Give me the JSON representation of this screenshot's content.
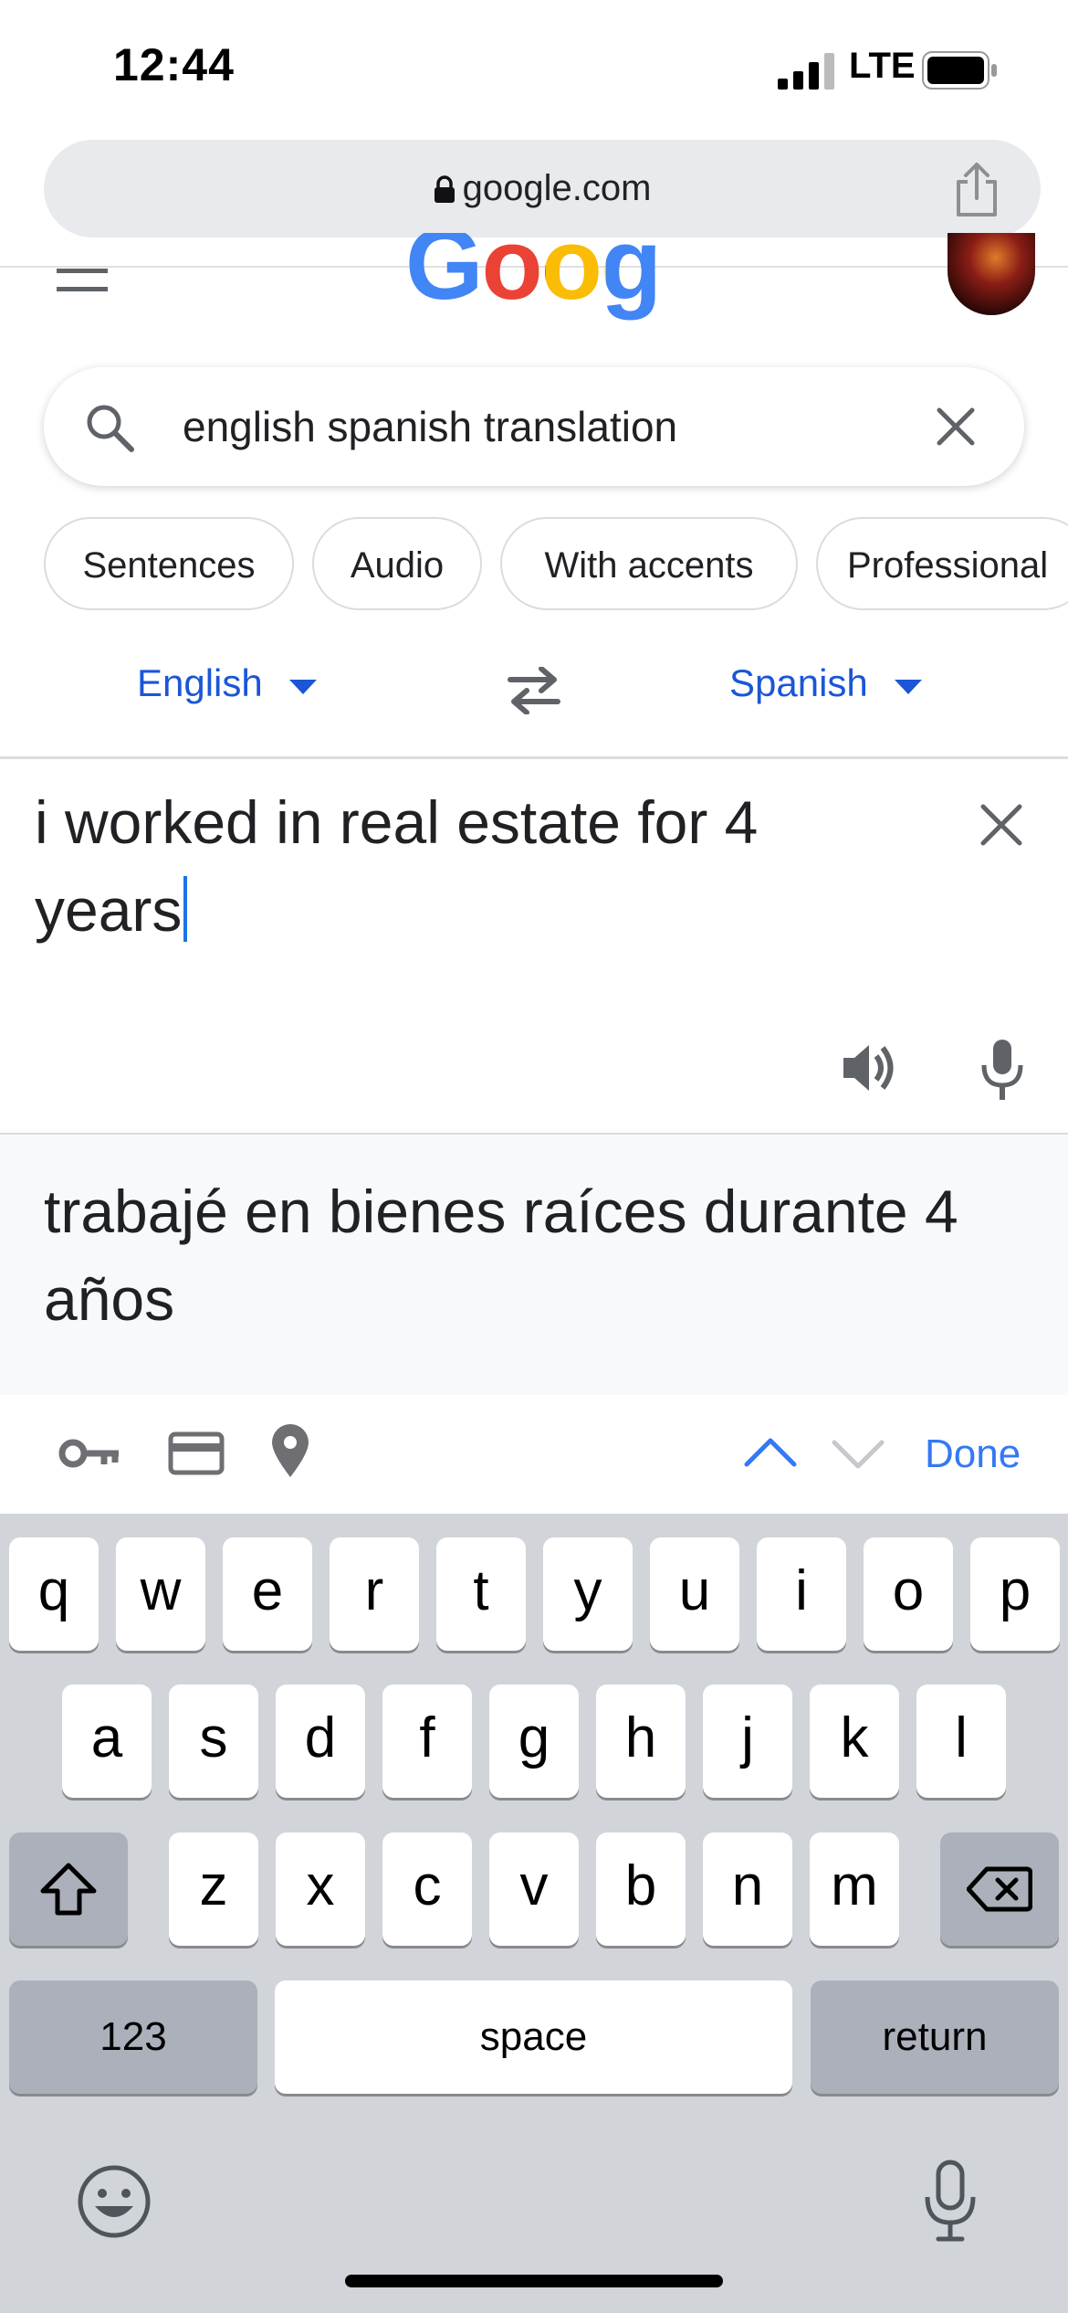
{
  "status_bar": {
    "time": "12:44",
    "network": "LTE"
  },
  "browser": {
    "url": "google.com"
  },
  "header": {
    "logo": "Google"
  },
  "search": {
    "query": "english spanish translation"
  },
  "chips": [
    "Sentences",
    "Audio",
    "With accents",
    "Professional"
  ],
  "translator": {
    "source_lang": "English",
    "target_lang": "Spanish",
    "source_text": "i worked in real estate for 4 years",
    "translated_text": "trabajé en bienes raíces durante 4 años"
  },
  "accessory": {
    "done_label": "Done"
  },
  "keyboard": {
    "row1": [
      "q",
      "w",
      "e",
      "r",
      "t",
      "y",
      "u",
      "i",
      "o",
      "p"
    ],
    "row2": [
      "a",
      "s",
      "d",
      "f",
      "g",
      "h",
      "j",
      "k",
      "l"
    ],
    "row3": [
      "z",
      "x",
      "c",
      "v",
      "b",
      "n",
      "m"
    ],
    "numbers_label": "123",
    "space_label": "space",
    "return_label": "return"
  },
  "colors": {
    "link_blue": "#1a56d6",
    "done_blue": "#3478f6",
    "keyboard_bg": "#d1d4d9"
  },
  "icons": [
    "signal-icon",
    "battery-icon",
    "lock-icon",
    "share-icon",
    "menu-icon",
    "search-icon",
    "clear-icon",
    "dropdown-icon",
    "swap-icon",
    "speaker-icon",
    "microphone-icon",
    "key-icon",
    "credit-card-icon",
    "location-icon",
    "chevron-up-icon",
    "chevron-down-icon",
    "shift-icon",
    "backspace-icon",
    "emoji-icon",
    "dictation-icon"
  ]
}
